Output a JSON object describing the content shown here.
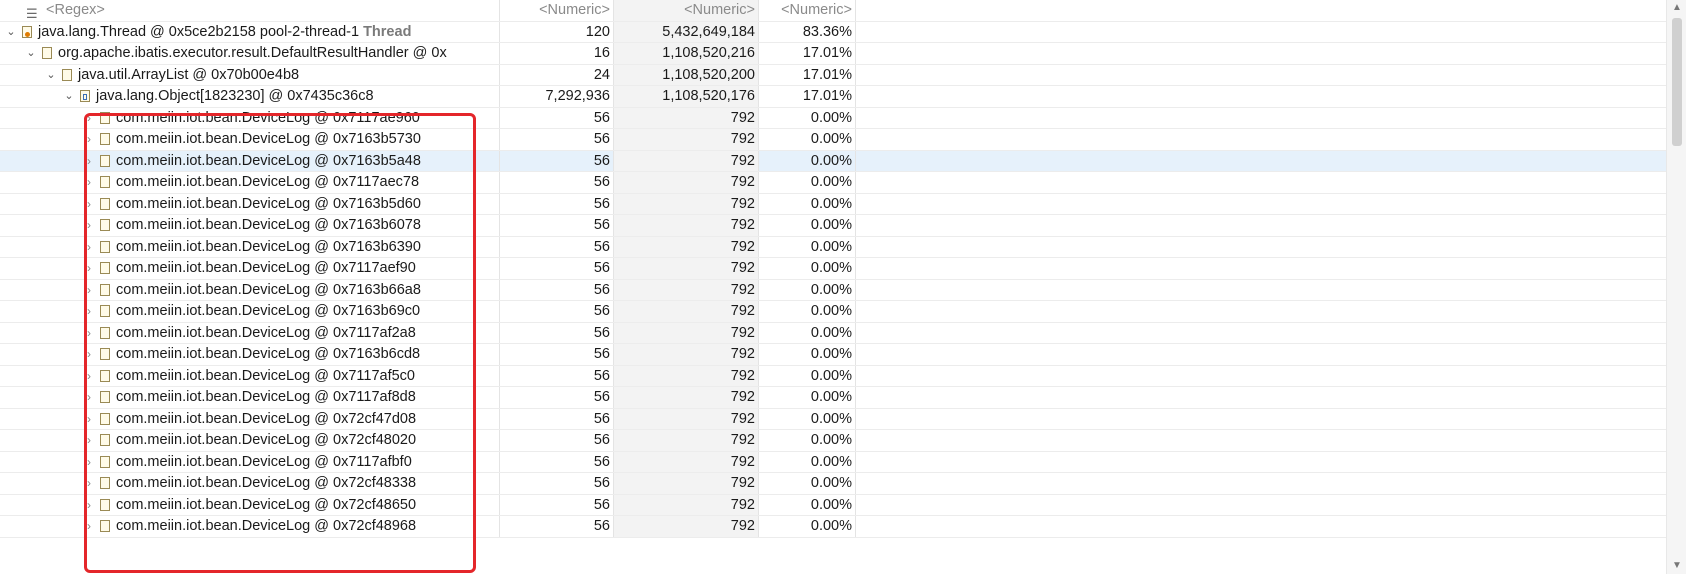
{
  "header": {
    "name_filter": "<Regex>",
    "shallow_filter": "<Numeric>",
    "retained_filter": "<Numeric>",
    "percent_filter": "<Numeric>"
  },
  "rows": [
    {
      "arrow": "expanded",
      "label": "java.lang.Thread @ 0x5ce2b2158  pool-2-thread-1 ",
      "suffix": "Thread",
      "shallow": "120",
      "retained": "5,432,649,184",
      "percent": "83.36%"
    },
    {
      "arrow": "expanded",
      "label": "org.apache.ibatis.executor.result.DefaultResultHandler @ 0x",
      "suffix": "",
      "shallow": "16",
      "retained": "1,108,520,216",
      "percent": "17.01%"
    },
    {
      "arrow": "expanded",
      "label": "java.util.ArrayList @ 0x70b00e4b8",
      "suffix": "",
      "shallow": "24",
      "retained": "1,108,520,200",
      "percent": "17.01%"
    },
    {
      "arrow": "expanded",
      "label": "java.lang.Object[1823230] @ 0x7435c36c8",
      "suffix": "",
      "shallow": "7,292,936",
      "retained": "1,108,520,176",
      "percent": "17.01%"
    },
    {
      "arrow": "collapsed",
      "label": "com.meiin.iot.bean.DeviceLog @ 0x7117ae960",
      "suffix": "",
      "shallow": "56",
      "retained": "792",
      "percent": "0.00%"
    },
    {
      "arrow": "collapsed",
      "label": "com.meiin.iot.bean.DeviceLog @ 0x7163b5730",
      "suffix": "",
      "shallow": "56",
      "retained": "792",
      "percent": "0.00%"
    },
    {
      "arrow": "collapsed",
      "label": "com.meiin.iot.bean.DeviceLog @ 0x7163b5a48",
      "suffix": "",
      "shallow": "56",
      "retained": "792",
      "percent": "0.00%"
    },
    {
      "arrow": "collapsed",
      "label": "com.meiin.iot.bean.DeviceLog @ 0x7117aec78",
      "suffix": "",
      "shallow": "56",
      "retained": "792",
      "percent": "0.00%"
    },
    {
      "arrow": "collapsed",
      "label": "com.meiin.iot.bean.DeviceLog @ 0x7163b5d60",
      "suffix": "",
      "shallow": "56",
      "retained": "792",
      "percent": "0.00%"
    },
    {
      "arrow": "collapsed",
      "label": "com.meiin.iot.bean.DeviceLog @ 0x7163b6078",
      "suffix": "",
      "shallow": "56",
      "retained": "792",
      "percent": "0.00%"
    },
    {
      "arrow": "collapsed",
      "label": "com.meiin.iot.bean.DeviceLog @ 0x7163b6390",
      "suffix": "",
      "shallow": "56",
      "retained": "792",
      "percent": "0.00%"
    },
    {
      "arrow": "collapsed",
      "label": "com.meiin.iot.bean.DeviceLog @ 0x7117aef90",
      "suffix": "",
      "shallow": "56",
      "retained": "792",
      "percent": "0.00%"
    },
    {
      "arrow": "collapsed",
      "label": "com.meiin.iot.bean.DeviceLog @ 0x7163b66a8",
      "suffix": "",
      "shallow": "56",
      "retained": "792",
      "percent": "0.00%"
    },
    {
      "arrow": "collapsed",
      "label": "com.meiin.iot.bean.DeviceLog @ 0x7163b69c0",
      "suffix": "",
      "shallow": "56",
      "retained": "792",
      "percent": "0.00%"
    },
    {
      "arrow": "collapsed",
      "label": "com.meiin.iot.bean.DeviceLog @ 0x7117af2a8",
      "suffix": "",
      "shallow": "56",
      "retained": "792",
      "percent": "0.00%"
    },
    {
      "arrow": "collapsed",
      "label": "com.meiin.iot.bean.DeviceLog @ 0x7163b6cd8",
      "suffix": "",
      "shallow": "56",
      "retained": "792",
      "percent": "0.00%"
    },
    {
      "arrow": "collapsed",
      "label": "com.meiin.iot.bean.DeviceLog @ 0x7117af5c0",
      "suffix": "",
      "shallow": "56",
      "retained": "792",
      "percent": "0.00%"
    },
    {
      "arrow": "collapsed",
      "label": "com.meiin.iot.bean.DeviceLog @ 0x7117af8d8",
      "suffix": "",
      "shallow": "56",
      "retained": "792",
      "percent": "0.00%"
    },
    {
      "arrow": "collapsed",
      "label": "com.meiin.iot.bean.DeviceLog @ 0x72cf47d08",
      "suffix": "",
      "shallow": "56",
      "retained": "792",
      "percent": "0.00%"
    },
    {
      "arrow": "collapsed",
      "label": "com.meiin.iot.bean.DeviceLog @ 0x72cf48020",
      "suffix": "",
      "shallow": "56",
      "retained": "792",
      "percent": "0.00%"
    },
    {
      "arrow": "collapsed",
      "label": "com.meiin.iot.bean.DeviceLog @ 0x7117afbf0",
      "suffix": "",
      "shallow": "56",
      "retained": "792",
      "percent": "0.00%"
    },
    {
      "arrow": "collapsed",
      "label": "com.meiin.iot.bean.DeviceLog @ 0x72cf48338",
      "suffix": "",
      "shallow": "56",
      "retained": "792",
      "percent": "0.00%"
    },
    {
      "arrow": "collapsed",
      "label": "com.meiin.iot.bean.DeviceLog @ 0x72cf48650",
      "suffix": "",
      "shallow": "56",
      "retained": "792",
      "percent": "0.00%"
    },
    {
      "arrow": "collapsed",
      "label": "com.meiin.iot.bean.DeviceLog @ 0x72cf48968",
      "suffix": "",
      "shallow": "56",
      "retained": "792",
      "percent": "0.00%"
    }
  ],
  "icons": {
    "thread": "thread-object-icon",
    "object": "object-instance-icon",
    "array": "array-object-icon",
    "regex": "regex-filter-icon"
  },
  "colors": {
    "highlight": "#e4262a",
    "selected_row": "#e6f1fb"
  }
}
